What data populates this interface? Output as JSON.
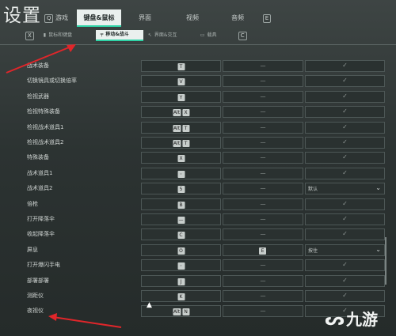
{
  "header": {
    "title": "设置"
  },
  "tabs": [
    {
      "label": "游戏",
      "key": "Q",
      "active": false
    },
    {
      "label": "键盘&鼠标",
      "active": true
    },
    {
      "label": "界面",
      "active": false
    },
    {
      "label": "视频",
      "active": false
    },
    {
      "label": "音频",
      "active": false
    },
    {
      "label": "E",
      "active": false
    }
  ],
  "subtabs": [
    {
      "label": "",
      "key": "X",
      "active": false
    },
    {
      "label": "鼠标和键盘",
      "active": false
    },
    {
      "label": "移动&战斗",
      "active": true
    },
    {
      "label": "界面&交互",
      "active": false
    },
    {
      "label": "载具",
      "active": false
    },
    {
      "label": "",
      "key": "C",
      "active": false
    }
  ],
  "rows": [
    {
      "label": "战术装备",
      "keys": [
        "T"
      ],
      "alt": "—",
      "third": "✓"
    },
    {
      "label": "切换镜具或切换倍率",
      "keys": [
        "V"
      ],
      "alt": "—",
      "third": "✓"
    },
    {
      "label": "检视武器",
      "keys": [
        "Y"
      ],
      "alt": "—",
      "third": "✓"
    },
    {
      "label": "检视特殊装备",
      "keys": [
        "Alt",
        "X"
      ],
      "alt": "—",
      "third": "✓"
    },
    {
      "label": "检视战术道具1",
      "keys": [
        "Alt",
        "T"
      ],
      "alt": "—",
      "third": "✓"
    },
    {
      "label": "检视战术道具2",
      "keys": [
        "Alt",
        "T"
      ],
      "alt": "—",
      "third": "✓"
    },
    {
      "label": "特殊装备",
      "keys": [
        "X"
      ],
      "alt": "—",
      "third": "✓"
    },
    {
      "label": "战术道具1",
      "keys": [
        "◦"
      ],
      "alt": "—",
      "third": "✓"
    },
    {
      "label": "战术道具2",
      "keys": [
        "5"
      ],
      "alt": "—",
      "third": "默认",
      "dropdown": true
    },
    {
      "label": "倍枪",
      "keys": [
        "B"
      ],
      "alt": "—",
      "third": "✓"
    },
    {
      "label": "打开降落伞",
      "keys": [
        "—"
      ],
      "alt": "—",
      "third": "✓"
    },
    {
      "label": "收起降落伞",
      "keys": [
        "C"
      ],
      "alt": "—",
      "third": "✓"
    },
    {
      "label": "屏息",
      "keys": [
        "O"
      ],
      "alt": "E",
      "third": "按住",
      "dropdown": true
    },
    {
      "label": "打开爆闪手电",
      "keys": [
        "◦"
      ],
      "alt": "—",
      "third": "✓"
    },
    {
      "label": "部署部署",
      "keys": [
        "J"
      ],
      "alt": "—",
      "third": "✓"
    },
    {
      "label": "测距仪",
      "keys": [
        "K"
      ],
      "alt": "—",
      "third": "✓"
    },
    {
      "label": "夜视仪",
      "keys": [
        "Alt",
        "N"
      ],
      "alt": "—",
      "third": "✓"
    }
  ],
  "watermark": {
    "text": "九游"
  }
}
